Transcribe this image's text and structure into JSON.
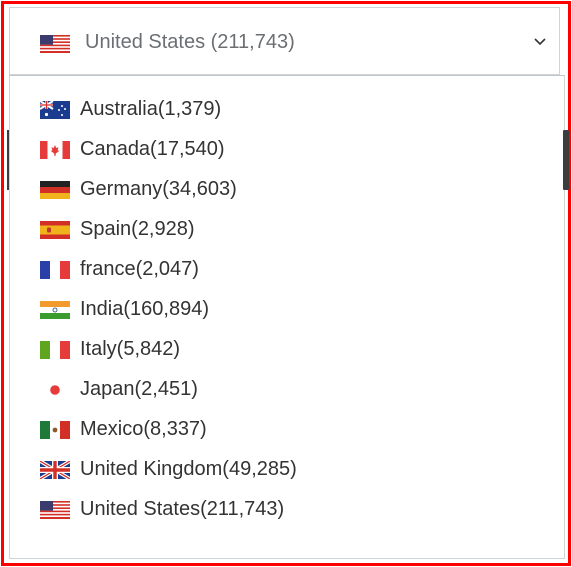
{
  "select": {
    "selected_label": "United States (211,743)",
    "selected_flag": "us-flag-icon"
  },
  "options": [
    {
      "label": "Australia(1,379)",
      "flag": "australia-flag-icon"
    },
    {
      "label": "Canada(17,540)",
      "flag": "canada-flag-icon"
    },
    {
      "label": "Germany(34,603)",
      "flag": "germany-flag-icon"
    },
    {
      "label": "Spain(2,928)",
      "flag": "spain-flag-icon"
    },
    {
      "label": "france(2,047)",
      "flag": "france-flag-icon"
    },
    {
      "label": "India(160,894)",
      "flag": "india-flag-icon"
    },
    {
      "label": "Italy(5,842)",
      "flag": "italy-flag-icon"
    },
    {
      "label": "Japan(2,451)",
      "flag": "japan-flag-icon"
    },
    {
      "label": "Mexico(8,337)",
      "flag": "mexico-flag-icon"
    },
    {
      "label": "United Kingdom(49,285)",
      "flag": "uk-flag-icon"
    },
    {
      "label": "United States(211,743)",
      "flag": "us-flag-icon"
    }
  ],
  "colors": {
    "highlight_border": "#ff0000",
    "border": "#cfd4d8"
  }
}
